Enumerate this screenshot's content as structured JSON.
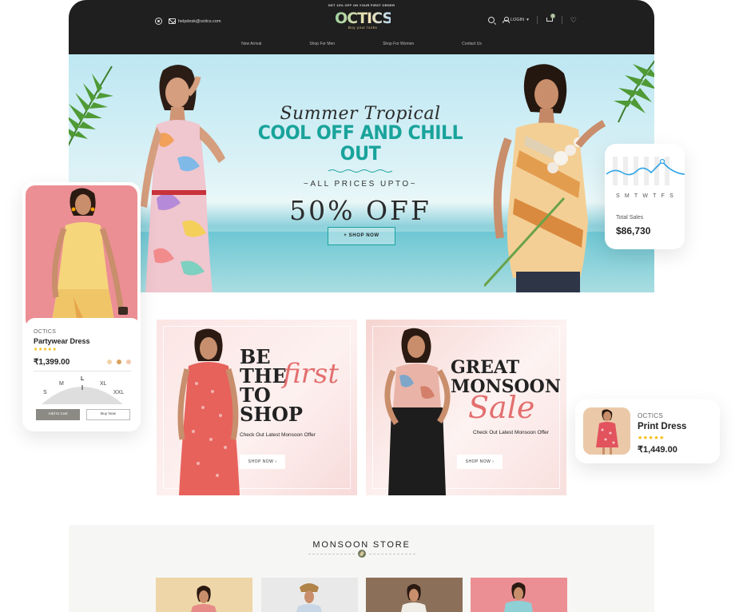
{
  "header": {
    "promo": "GET 10% OFF ON YOUR FIRST ORDER",
    "email": "helpdesk@octics.com",
    "logo": "OCTICS",
    "tagline": "Buy your looks",
    "login_label": "LOGIN",
    "cart_count": "0",
    "nav": [
      "New Arrival",
      "Shop For Men",
      "Shop For Women",
      "Contact Us"
    ]
  },
  "hero": {
    "script": "Summer Tropical",
    "headline": "COOL OFF AND CHILL OUT",
    "sub": "~ALL PRICES UPTO~",
    "price": "50% OFF",
    "cta": "+ SHOP NOW"
  },
  "tiles": [
    {
      "line1": "BE",
      "line2": "THE",
      "script": "first",
      "line3": "TO",
      "line4": "SHOP",
      "sub": "Check Out Latest Monsoon Offer",
      "cta": "SHOP NOW ›"
    },
    {
      "line1": "GREAT",
      "line2": "MONSOON",
      "script": "Sale",
      "sub": "Check Out Latest Monsoon Offer",
      "cta": "SHOP NOW ›"
    }
  ],
  "store": {
    "title": "MONSOON STORE"
  },
  "product_card": {
    "brand": "OCTICS",
    "name": "Partywear Dress",
    "stars": "★★★★★",
    "price": "₹1,399.00",
    "sizes": [
      "S",
      "M",
      "L",
      "XL",
      "XXL"
    ],
    "add_to_cart": "Add to Cart",
    "buy_now": "Buy Now",
    "swatches": [
      "#f1d3a8",
      "#d9a15d",
      "#f2c9ad"
    ]
  },
  "sales_card": {
    "days": [
      "S",
      "M",
      "T",
      "W",
      "T",
      "F",
      "S"
    ],
    "label": "Total Sales",
    "value": "$86,730"
  },
  "print_card": {
    "brand": "OCTICS",
    "name": "Print Dress",
    "stars": "★★★★★",
    "price": "₹1,449.00"
  },
  "colors": {
    "accent_teal": "#19a39b",
    "header_bg": "#1f1f1f",
    "tile_script": "#e36f6f",
    "star": "#f2b800",
    "chart_line": "#2fa4e7"
  }
}
